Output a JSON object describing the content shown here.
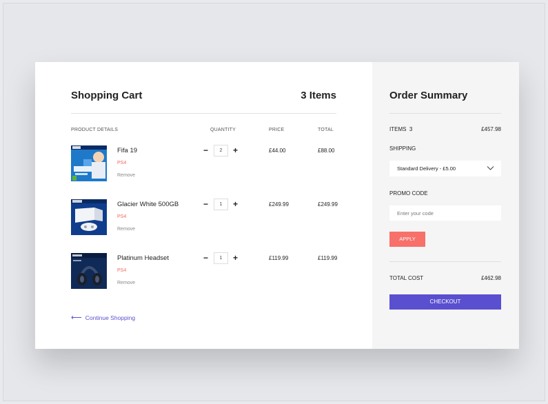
{
  "cart": {
    "title": "Shopping Cart",
    "item_count": "3 Items",
    "columns": {
      "details": "PRODUCT DETAILS",
      "quantity": "QUANTITY",
      "price": "PRICE",
      "total": "TOTAL"
    },
    "items": [
      {
        "name": "Fifa 19",
        "platform": "PS4",
        "remove": "Remove",
        "quantity": "2",
        "price": "£44.00",
        "total": "£88.00",
        "image": "fifa-19-cover"
      },
      {
        "name": "Glacier White 500GB",
        "platform": "PS4",
        "remove": "Remove",
        "quantity": "1",
        "price": "£249.99",
        "total": "£249.99",
        "image": "ps4-glacier-white-box"
      },
      {
        "name": "Platinum Headset",
        "platform": "PS4",
        "remove": "Remove",
        "quantity": "1",
        "price": "£119.99",
        "total": "£119.99",
        "image": "platinum-headset-box"
      }
    ],
    "continue_label": "Continue Shopping",
    "icons": {
      "minus": "−",
      "plus": "+",
      "back_arrow": "⟵"
    }
  },
  "summary": {
    "title": "Order Summary",
    "items_label": "ITEMS",
    "items_count": "3",
    "items_total": "£457.98",
    "shipping_label": "SHIPPING",
    "shipping_option": "Standard Delivery - £5.00",
    "promo_label": "PROMO CODE",
    "promo_placeholder": "Enter your code",
    "apply_label": "APPLY",
    "total_label": "TOTAL COST",
    "total_value": "£462.98",
    "checkout_label": "CHECKOUT"
  },
  "colors": {
    "accent": "#5a4fcf",
    "apply": "#f7706a",
    "platform_text": "#f26a5a",
    "summary_bg": "#f5f5f6"
  }
}
